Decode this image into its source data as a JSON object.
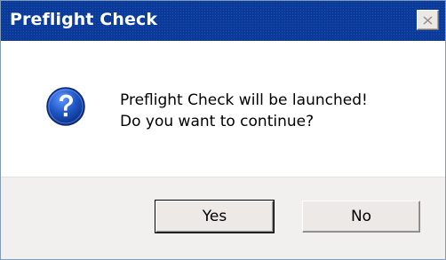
{
  "dialog": {
    "title": "Preflight Check",
    "icon": "question-icon",
    "message_line1": "Preflight Check will be launched!",
    "message_line2": "Do you want to continue?"
  },
  "buttons": {
    "yes_label": "Yes",
    "no_label": "No"
  },
  "titlebar": {
    "close_icon": "close-icon"
  },
  "colors": {
    "titlebar": "#0a3a9a",
    "icon_blue": "#1f56c4",
    "button_face": "#ece9e6",
    "button_bar": "#f1f0ef"
  }
}
